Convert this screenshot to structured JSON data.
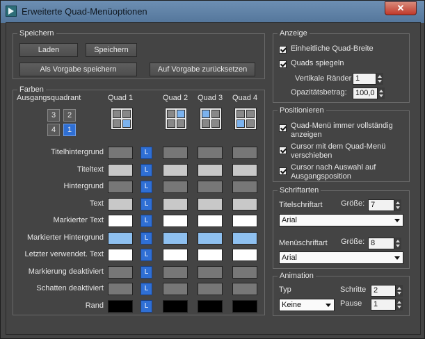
{
  "window": {
    "title": "Erweiterte Quad-Menüoptionen",
    "close_symbol": "✕"
  },
  "colors": {
    "panel_bg": "#444444",
    "swatch_dark": "#777777",
    "swatch_mid": "#999999",
    "swatch_light": "#c8c8c8",
    "swatch_white": "#ffffff",
    "swatch_blue": "#8ec0f0",
    "swatch_black": "#000000",
    "accent_blue": "#2f6fd4"
  },
  "speichern": {
    "label": "Speichern",
    "laden": "Laden",
    "speichern": "Speichern",
    "als_vorgabe": "Als Vorgabe speichern",
    "auf_vorgabe": "Auf Vorgabe zurücksetzen"
  },
  "farben": {
    "label": "Farben",
    "ausgangsquadrant": "Ausgangsquadrant",
    "quadrants": [
      "3",
      "2",
      "4",
      "1"
    ],
    "selected_quadrant": "1",
    "quad_headers": [
      "Quad 1",
      "Quad 2",
      "Quad 3",
      "Quad 4"
    ],
    "lock_label": "L",
    "rows": [
      {
        "label": "Titelhintergrund",
        "swatches": [
          "swatch_dark",
          "swatch_dark",
          "swatch_dark",
          "swatch_dark"
        ]
      },
      {
        "label": "Titeltext",
        "swatches": [
          "swatch_light",
          "swatch_light",
          "swatch_light",
          "swatch_light"
        ]
      },
      {
        "label": "Hintergrund",
        "swatches": [
          "swatch_dark",
          "swatch_dark",
          "swatch_dark",
          "swatch_dark"
        ]
      },
      {
        "label": "Text",
        "swatches": [
          "swatch_light",
          "swatch_light",
          "swatch_light",
          "swatch_light"
        ]
      },
      {
        "label": "Markierter Text",
        "swatches": [
          "swatch_white",
          "swatch_white",
          "swatch_white",
          "swatch_white"
        ]
      },
      {
        "label": "Markierter Hintergrund",
        "swatches": [
          "swatch_blue",
          "swatch_blue",
          "swatch_blue",
          "swatch_blue"
        ]
      },
      {
        "label": "Letzter verwendet. Text",
        "swatches": [
          "swatch_white",
          "swatch_white",
          "swatch_white",
          "swatch_white"
        ]
      },
      {
        "label": "Markierung deaktiviert",
        "swatches": [
          "swatch_dark",
          "swatch_dark",
          "swatch_dark",
          "swatch_dark"
        ]
      },
      {
        "label": "Schatten deaktiviert",
        "swatches": [
          "swatch_dark",
          "swatch_dark",
          "swatch_dark",
          "swatch_dark"
        ]
      },
      {
        "label": "Rand",
        "swatches": [
          "swatch_black",
          "swatch_black",
          "swatch_black",
          "swatch_black"
        ]
      }
    ]
  },
  "anzeige": {
    "label": "Anzeige",
    "einheitliche": "Einheitliche Quad-Breite",
    "spiegeln": "Quads spiegeln",
    "vertikale_raender": "Vertikale Ränder",
    "vertikale_raender_value": "1",
    "opazitaet": "Opazitätsbetrag:",
    "opazitaet_value": "100,0"
  },
  "positionieren": {
    "label": "Positionieren",
    "immer_line1": "Quad-Menü immer vollständig",
    "immer_line2": "anzeigen",
    "cursor_line1": "Cursor mit dem Quad-Menü",
    "cursor_line2": "verschieben",
    "nach_line1": "Cursor nach Auswahl auf",
    "nach_line2": "Ausgangsposition"
  },
  "schriftarten": {
    "label": "Schriftarten",
    "titel": "Titelschriftart",
    "titel_groesse_label": "Größe:",
    "titel_groesse": "7",
    "titel_font": "Arial",
    "menue": "Menüschriftart",
    "menue_groesse_label": "Größe:",
    "menue_groesse": "8",
    "menue_font": "Arial"
  },
  "animation": {
    "label": "Animation",
    "typ": "Typ",
    "typ_value": "Keine",
    "schritte": "Schritte",
    "schritte_value": "2",
    "pause": "Pause",
    "pause_value": "1"
  }
}
